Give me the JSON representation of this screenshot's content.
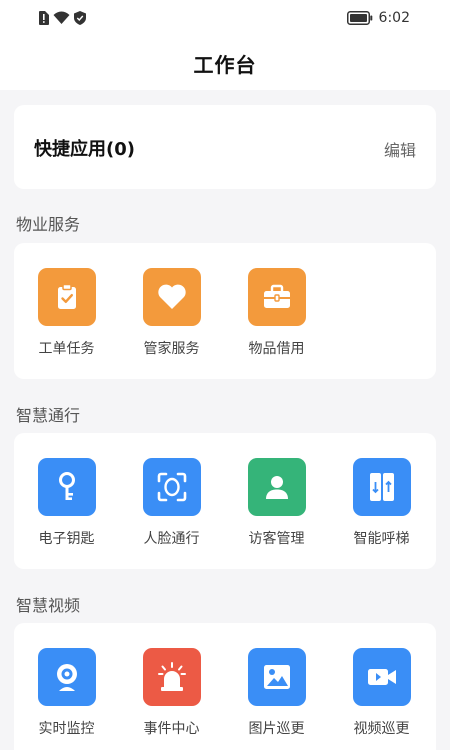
{
  "status_bar": {
    "icons": [
      "sim-alert-icon",
      "wifi-icon",
      "shield-icon",
      "battery-icon"
    ],
    "time": "6:02"
  },
  "header": {
    "title": "工作台"
  },
  "quick_apps": {
    "title": "快捷应用(0)",
    "edit_label": "编辑"
  },
  "sections": [
    {
      "title": "物业服务",
      "apps": [
        {
          "label": "工单任务",
          "icon": "clipboard-check-icon",
          "color": "#F39A3C"
        },
        {
          "label": "管家服务",
          "icon": "heart-icon",
          "color": "#F39A3C"
        },
        {
          "label": "物品借用",
          "icon": "toolbox-icon",
          "color": "#F39A3C"
        }
      ]
    },
    {
      "title": "智慧通行",
      "apps": [
        {
          "label": "电子钥匙",
          "icon": "key-icon",
          "color": "#3A8EF6"
        },
        {
          "label": "人脸通行",
          "icon": "face-scan-icon",
          "color": "#3A8EF6"
        },
        {
          "label": "访客管理",
          "icon": "person-icon",
          "color": "#35B479"
        },
        {
          "label": "智能呼梯",
          "icon": "elevator-icon",
          "color": "#3A8EF6"
        }
      ]
    },
    {
      "title": "智慧视频",
      "apps": [
        {
          "label": "实时监控",
          "icon": "camera-icon",
          "color": "#3A8EF6"
        },
        {
          "label": "事件中心",
          "icon": "alarm-light-icon",
          "color": "#EC5A45"
        },
        {
          "label": "图片巡更",
          "icon": "image-icon",
          "color": "#3A8EF6"
        },
        {
          "label": "视频巡更",
          "icon": "video-icon",
          "color": "#3A8EF6"
        }
      ]
    }
  ]
}
